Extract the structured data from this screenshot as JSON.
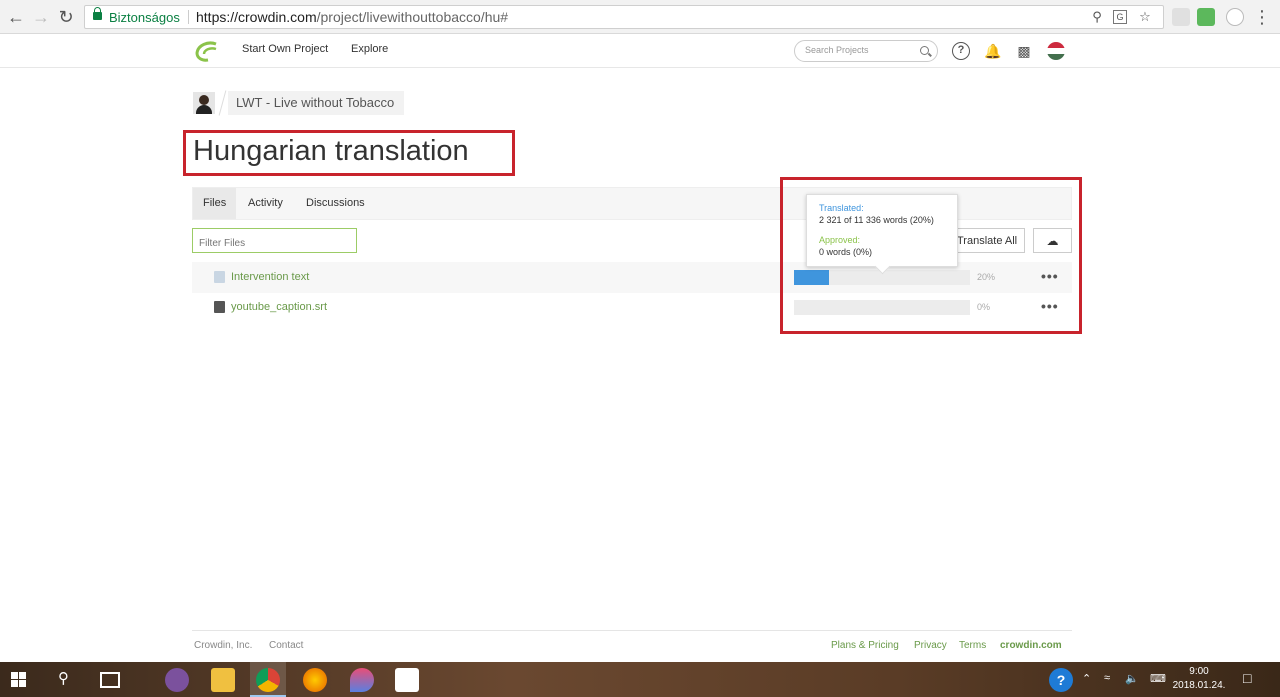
{
  "browser": {
    "secure_label": "Biztonságos",
    "url_host": "https://crowdin.com",
    "url_path": "/project/livewithouttobacco/hu#"
  },
  "header": {
    "start_project": "Start Own Project",
    "explore": "Explore",
    "search_placeholder": "Search Projects"
  },
  "breadcrumb": {
    "project": "LWT - Live without Tobacco"
  },
  "page_title": "Hungarian translation",
  "tabs": [
    {
      "label": "Files",
      "active": true
    },
    {
      "label": "Activity",
      "active": false
    },
    {
      "label": "Discussions",
      "active": false
    }
  ],
  "filter_placeholder": "Filter Files",
  "translate_all_label": "Translate All",
  "files": [
    {
      "name": "Intervention text",
      "progress_pct": 20,
      "progress_label": "20%"
    },
    {
      "name": "youtube_caption.srt",
      "progress_pct": 0,
      "progress_label": "0%"
    }
  ],
  "tooltip": {
    "translated_label": "Translated:",
    "translated_value": "2 321 of 11 336 words (20%)",
    "approved_label": "Approved:",
    "approved_value": "0 words (0%)"
  },
  "footer": {
    "company": "Crowdin, Inc.",
    "contact": "Contact",
    "plans": "Plans & Pricing",
    "privacy": "Privacy",
    "terms": "Terms",
    "brand": "crowdin.com"
  },
  "taskbar": {
    "time": "9:00",
    "date": "2018.01.24."
  },
  "colors": {
    "accent_blue": "#3f95dd",
    "highlight_red": "#c8232c",
    "link_green": "#6a9a4a"
  }
}
